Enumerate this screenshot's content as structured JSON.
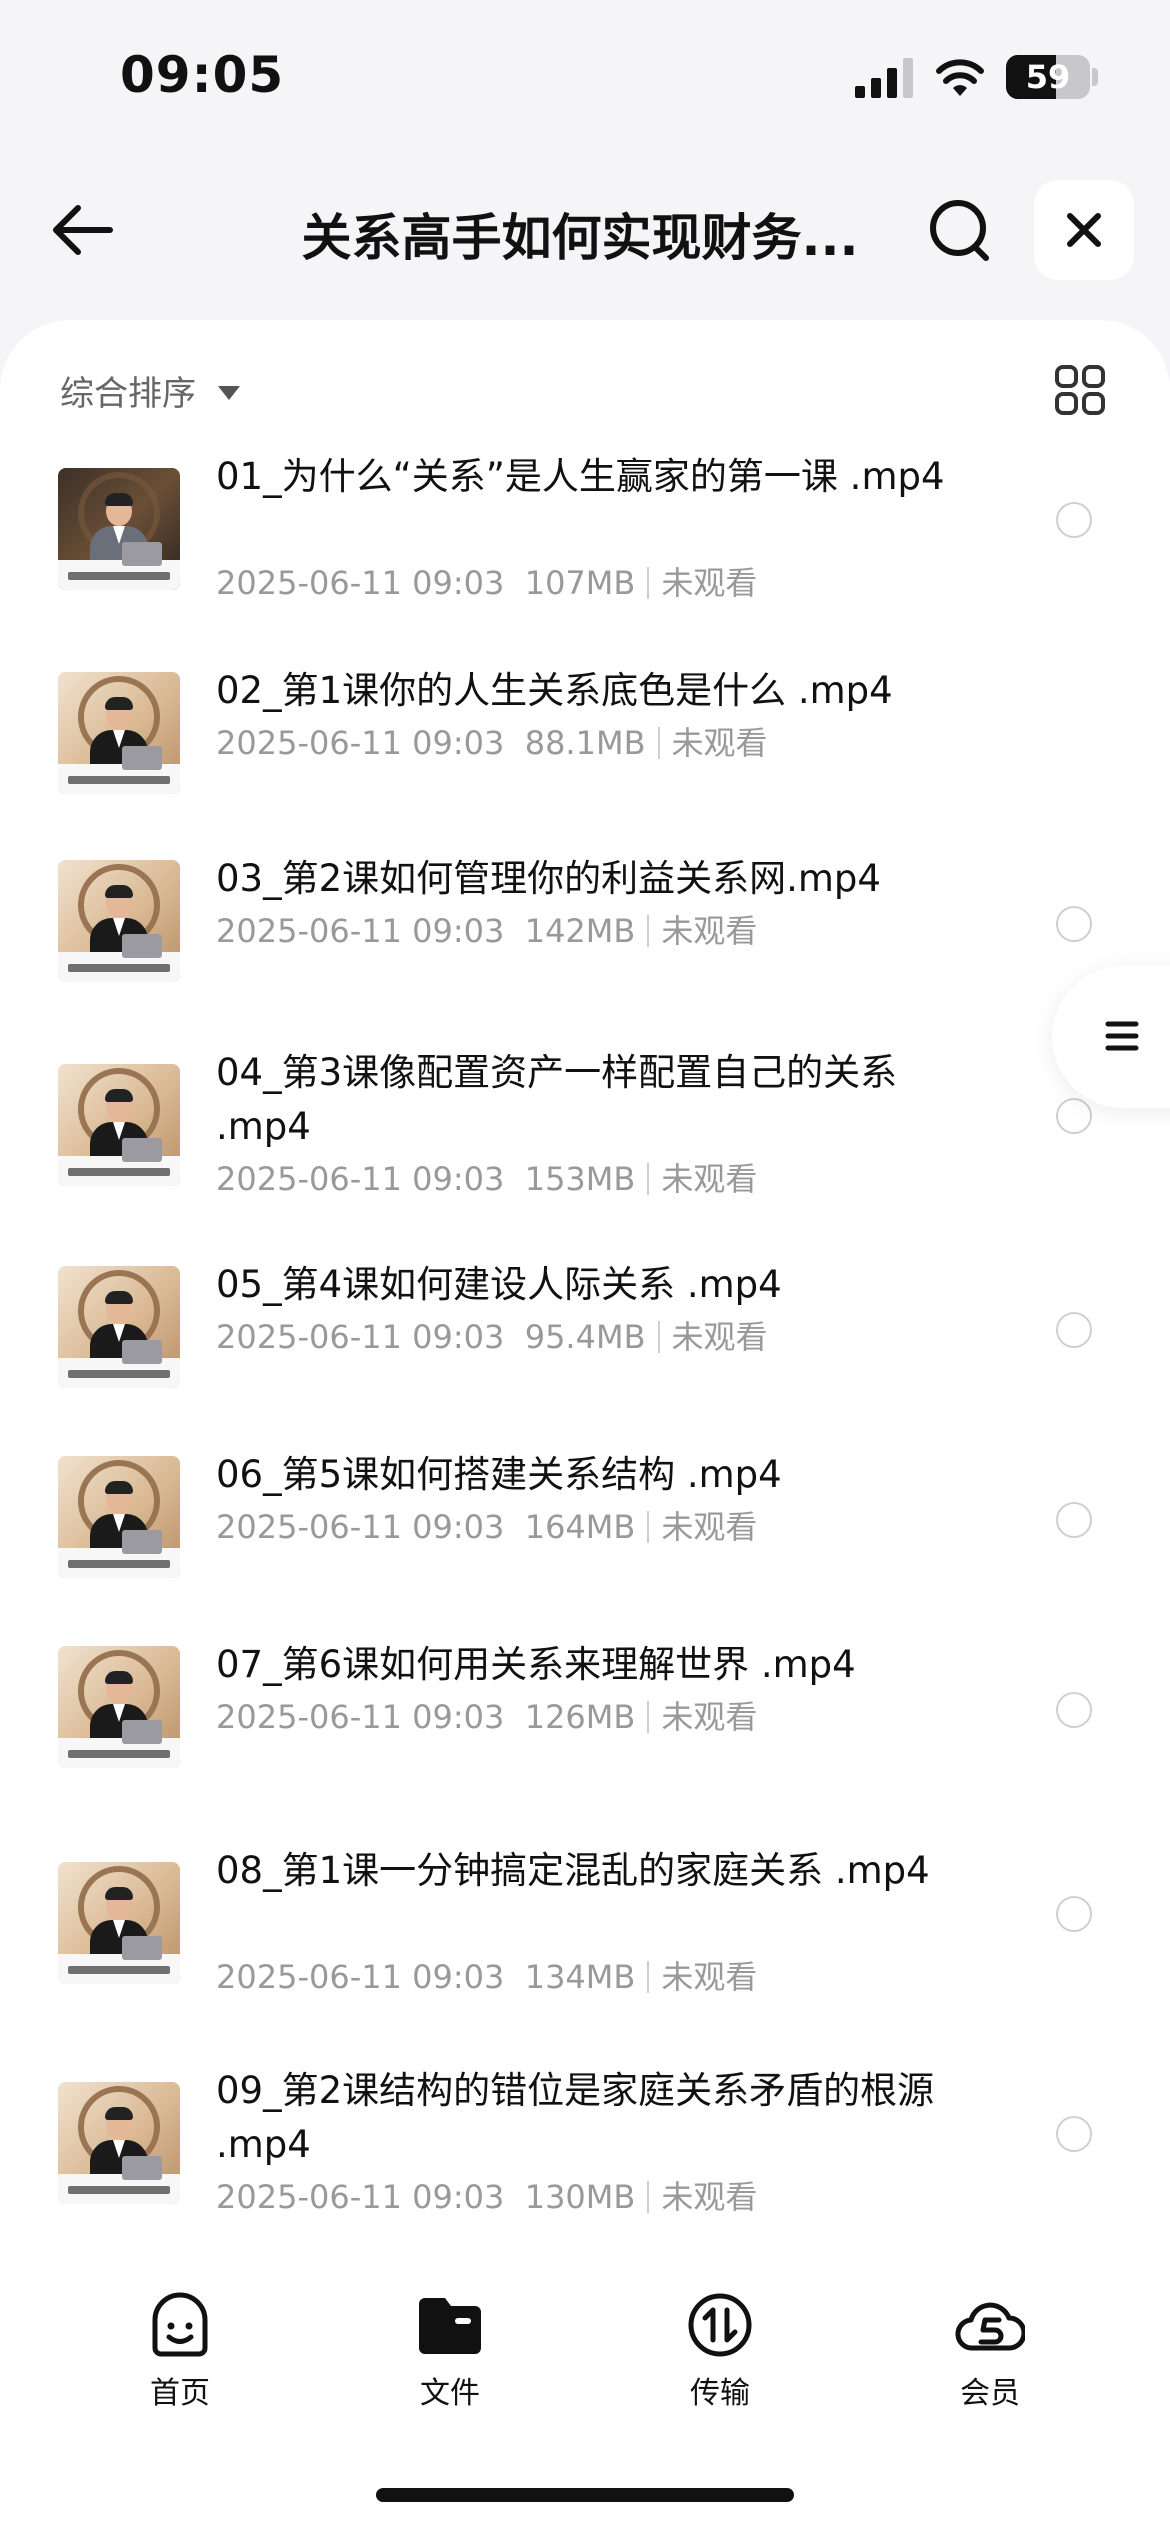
{
  "status_bar": {
    "time": "09:05",
    "battery": "59",
    "battery_level": 0.59
  },
  "header": {
    "title": "关系高手如何实现财务..."
  },
  "toolbar": {
    "sort_label": "综合排序"
  },
  "files": [
    {
      "name": "01_为什么“关系”是人生赢家的第一课 .mp4",
      "date": "2025-06-11 09:03",
      "size": "107MB",
      "status": "未观看"
    },
    {
      "name": "02_第1课你的人生关系底色是什么 .mp4",
      "date": "2025-06-11 09:03",
      "size": "88.1MB",
      "status": "未观看"
    },
    {
      "name": "03_第2课如何管理你的利益关系网.mp4",
      "date": "2025-06-11 09:03",
      "size": "142MB",
      "status": "未观看"
    },
    {
      "name": "04_第3课像配置资产一样配置自己的关系 .mp4",
      "date": "2025-06-11 09:03",
      "size": "153MB",
      "status": "未观看"
    },
    {
      "name": "05_第4课如何建设人际关系 .mp4",
      "date": "2025-06-11 09:03",
      "size": "95.4MB",
      "status": "未观看"
    },
    {
      "name": "06_第5课如何搭建关系结构 .mp4",
      "date": "2025-06-11 09:03",
      "size": "164MB",
      "status": "未观看"
    },
    {
      "name": "07_第6课如何用关系来理解世界 .mp4",
      "date": "2025-06-11 09:03",
      "size": "126MB",
      "status": "未观看"
    },
    {
      "name": "08_第1课一分钟搞定混乱的家庭关系 .mp4",
      "date": "2025-06-11 09:03",
      "size": "134MB",
      "status": "未观看"
    },
    {
      "name": "09_第2课结构的错位是家庭关系矛盾的根源 .mp4",
      "date": "2025-06-11 09:03",
      "size": "130MB",
      "status": "未观看"
    }
  ],
  "tabbar": {
    "items": [
      {
        "label": "首页",
        "icon": "home-face-icon"
      },
      {
        "label": "文件",
        "icon": "folder-icon"
      },
      {
        "label": "传输",
        "icon": "transfer-icon"
      },
      {
        "label": "会员",
        "icon": "member-cloud-icon"
      }
    ]
  }
}
